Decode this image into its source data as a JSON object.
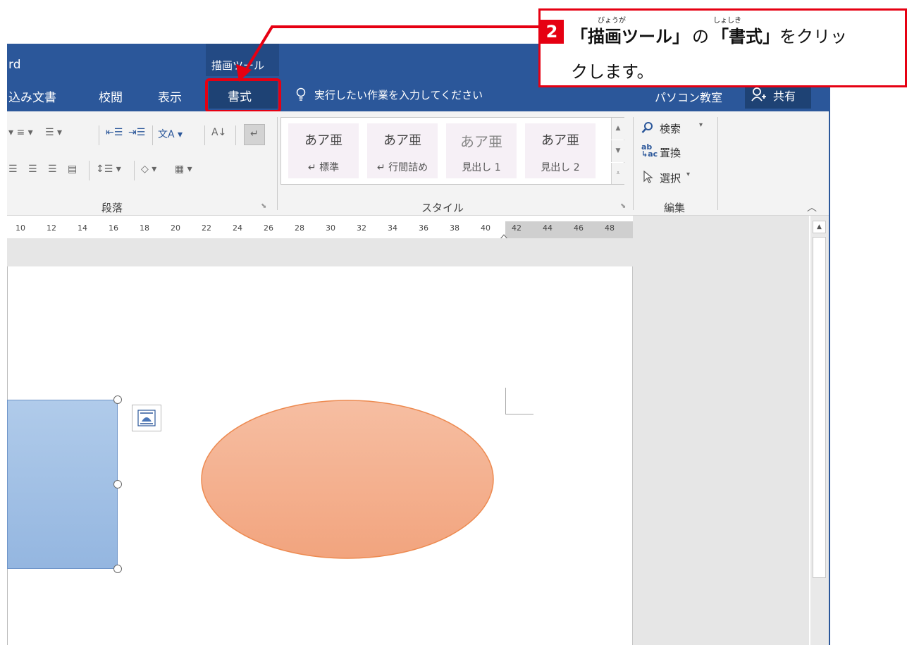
{
  "app_title_fragment": "rd",
  "contextual_tab_group": "描画ツール",
  "tabs": [
    {
      "label": "込み文書"
    },
    {
      "label": "校閲"
    },
    {
      "label": "表示"
    },
    {
      "label": "書式"
    }
  ],
  "tell_me": {
    "placeholder": "実行したい作業を入力してください"
  },
  "user_name": "パソコン教室",
  "share_label": "共有",
  "ribbon": {
    "paragraph_label": "段落",
    "styles_label": "スタイル",
    "editing_label": "編集",
    "styles": [
      {
        "sample": "あア亜",
        "name": "↵ 標準"
      },
      {
        "sample": "あア亜",
        "name": "↵ 行間詰め"
      },
      {
        "sample": "あア亜",
        "name": "見出し 1"
      },
      {
        "sample": "あア亜",
        "name": "見出し 2"
      }
    ],
    "editing": {
      "find": "検索",
      "replace": "置換",
      "select": "選択"
    }
  },
  "ruler_ticks": [
    "10",
    "12",
    "14",
    "16",
    "18",
    "20",
    "22",
    "24",
    "26",
    "28",
    "30",
    "32",
    "34",
    "36",
    "38",
    "40",
    "42",
    "44",
    "46",
    "48"
  ],
  "callout": {
    "step": "2",
    "text_part1": "「描画ツール」",
    "text_part2": "の",
    "text_part3": "「書式」",
    "text_part4": "をクリッ",
    "text_line2": "クします。",
    "ruby_drawing": "びょうが",
    "ruby_format": "しょしき"
  },
  "colors": {
    "ribbon_blue": "#2b579a",
    "highlight_red": "#e60012",
    "rectangle_fill": "#a2c0e6",
    "ellipse_fill": "#f4b08e"
  }
}
